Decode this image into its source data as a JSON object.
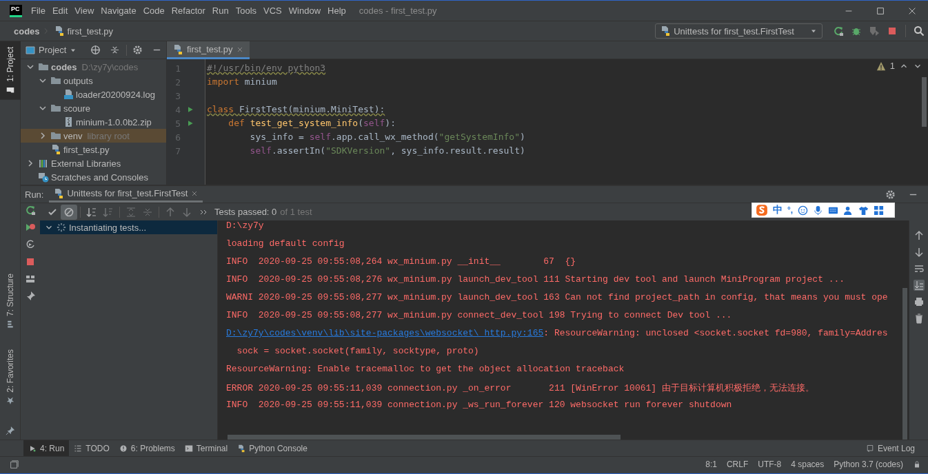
{
  "app": {
    "logo": "PC"
  },
  "menu": [
    {
      "label": "File"
    },
    {
      "label": "Edit"
    },
    {
      "label": "View"
    },
    {
      "label": "Navigate"
    },
    {
      "label": "Code"
    },
    {
      "label": "Refactor"
    },
    {
      "label": "Run"
    },
    {
      "label": "Tools"
    },
    {
      "label": "VCS"
    },
    {
      "label": "Window"
    },
    {
      "label": "Help"
    }
  ],
  "window": {
    "title": "codes - first_test.py"
  },
  "breadcrumb": [
    "codes",
    "first_test.py"
  ],
  "run_config": {
    "label": "Unittests for first_test.FirstTest"
  },
  "tool_strip": [
    {
      "label": "1: Project",
      "kind": "project",
      "selected": true
    },
    {
      "label": "7: Structure",
      "kind": "structure",
      "selected": false
    },
    {
      "label": "2: Favorites",
      "kind": "favorites",
      "selected": false
    }
  ],
  "project": {
    "title": "Project",
    "tree": [
      {
        "name": "codes",
        "hint": "D:\\zy7y\\codes",
        "kind": "project_root",
        "expanded": true,
        "selected": false,
        "children": [
          {
            "name": "outputs",
            "kind": "folder",
            "expanded": true,
            "selected": false,
            "children": [
              {
                "name": "loader20200924.log",
                "kind": "log",
                "selected": false
              }
            ]
          },
          {
            "name": "scoure",
            "kind": "folder",
            "expanded": true,
            "selected": false,
            "children": [
              {
                "name": "minium-1.0.0b2.zip",
                "kind": "zip",
                "selected": false
              }
            ]
          },
          {
            "name": "venv",
            "hint": "library root",
            "kind": "folder",
            "expanded": false,
            "selected": true
          },
          {
            "name": "first_test.py",
            "kind": "python",
            "selected": false
          }
        ]
      },
      {
        "name": "External Libraries",
        "kind": "libraries",
        "expanded": false,
        "selected": false
      },
      {
        "name": "Scratches and Consoles",
        "kind": "scratches",
        "selected": false
      }
    ]
  },
  "editor": {
    "tabs": [
      {
        "label": "first_test.py",
        "selected": true
      }
    ],
    "warnings": "1",
    "lines": [
      {
        "number": "1",
        "run_marker": false,
        "warning": true,
        "tokens": [
          {
            "kind": "comment",
            "text": "#!/usr/bin/env python3"
          }
        ]
      },
      {
        "number": "2",
        "run_marker": false,
        "tokens": [
          {
            "kind": "keyword",
            "text": "import "
          },
          {
            "kind": "plain",
            "text": "minium"
          }
        ]
      },
      {
        "number": "3",
        "run_marker": false
      },
      {
        "number": "4",
        "run_marker": true,
        "warning": true,
        "tokens": [
          {
            "kind": "keyword",
            "text": "class "
          },
          {
            "kind": "plain",
            "text": "FirstTest(minium.MiniTest):"
          }
        ]
      },
      {
        "number": "5",
        "run_marker": true,
        "tokens": [
          {
            "kind": "keyword",
            "text": "    def "
          },
          {
            "kind": "function",
            "text": "test_get_system_info"
          },
          {
            "kind": "plain",
            "text": "("
          },
          {
            "kind": "self",
            "text": "self"
          },
          {
            "kind": "plain",
            "text": "):"
          }
        ]
      },
      {
        "number": "6",
        "run_marker": false,
        "tokens": [
          {
            "kind": "plain",
            "text": "        sys_info = "
          },
          {
            "kind": "self",
            "text": "self"
          },
          {
            "kind": "plain",
            "text": ".app.call_wx_method("
          },
          {
            "kind": "string",
            "text": "\"getSystemInfo\""
          },
          {
            "kind": "plain",
            "text": ")"
          }
        ]
      },
      {
        "number": "7",
        "run_marker": false,
        "tokens": [
          {
            "kind": "self",
            "text": "        self"
          },
          {
            "kind": "plain",
            "text": ".assertIn("
          },
          {
            "kind": "string",
            "text": "\"SDKVersion\""
          },
          {
            "kind": "plain",
            "text": ", sys_info.result.result)"
          }
        ]
      }
    ]
  },
  "run": {
    "label": "Run:",
    "tabs": [
      {
        "label": "Unittests for first_test.FirstTest",
        "selected": true
      }
    ],
    "toolbar": [
      {
        "kind": "show_passed",
        "on": false
      },
      {
        "kind": "show_ignored",
        "on": true
      }
    ],
    "status": "Tests passed: 0",
    "status_detail": "of 1 test",
    "tests": [
      {
        "label": "Instantiating tests...",
        "expanded": true,
        "selected": true
      }
    ],
    "console": [
      {
        "kind": "text",
        "text": "D:\\zy7y"
      },
      {
        "kind": "text",
        "text": "loading default config"
      },
      {
        "kind": "text",
        "text": "INFO  2020-09-25 09:55:08,264 wx_minium.py __init__        67  {}"
      },
      {
        "kind": "text",
        "text": "INFO  2020-09-25 09:55:08,276 wx_minium.py launch_dev_tool 111 Starting dev tool and launch MiniProgram project ..."
      },
      {
        "kind": "text",
        "text": "WARNI 2020-09-25 09:55:08,277 wx_minium.py launch_dev_tool 163 Can not find project_path in config, that means you must ope"
      },
      {
        "kind": "text",
        "text": "INFO  2020-09-25 09:55:08,277 wx_minium.py connect_dev_tool 198 Trying to connect Dev tool ..."
      },
      {
        "kind": "link",
        "link": "D:\\zy7y\\codes\\venv\\lib\\site-packages\\websocket\\_http.py:165",
        "text": ": ResourceWarning: unclosed <socket.socket fd=980, family=Addres"
      },
      {
        "kind": "text",
        "text": "  sock = socket.socket(family, socktype, proto)"
      },
      {
        "kind": "text",
        "text": "ResourceWarning: Enable tracemalloc to get the object allocation traceback"
      },
      {
        "kind": "text",
        "text": "ERROR 2020-09-25 09:55:11,039 connection.py _on_error       211 [WinError 10061] 由于目标计算机积极拒绝，无法连接。"
      },
      {
        "kind": "text",
        "text": "INFO  2020-09-25 09:55:11,039 connection.py _ws_run_forever 120 websocket run forever shutdown"
      }
    ]
  },
  "ime": {
    "mode": "中",
    "punctuation": "°,"
  },
  "bottom_tabs": [
    {
      "label": "4: Run",
      "kind": "run",
      "selected": true
    },
    {
      "label": "TODO",
      "kind": "todo",
      "selected": false
    },
    {
      "label": "6: Problems",
      "kind": "problems",
      "selected": false
    },
    {
      "label": "Terminal",
      "kind": "terminal",
      "selected": false
    },
    {
      "label": "Python Console",
      "kind": "python_console",
      "selected": false
    }
  ],
  "event_log": "Event Log",
  "status_bar": [
    "8:1",
    "CRLF",
    "UTF-8",
    "4 spaces",
    "Python 3.7 (codes)"
  ]
}
